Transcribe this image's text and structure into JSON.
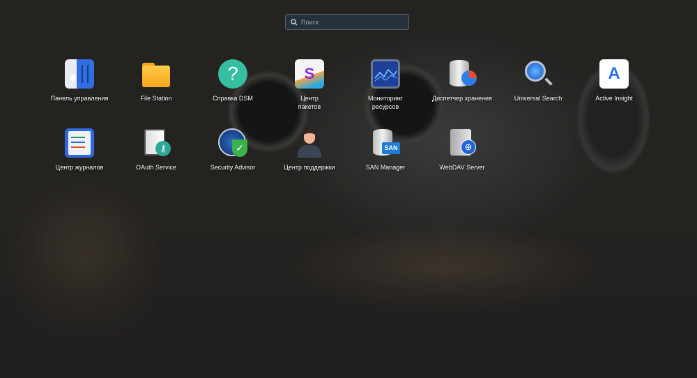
{
  "search": {
    "placeholder": "Поиск"
  },
  "apps": [
    {
      "label": "Панель управления"
    },
    {
      "label": "File Station"
    },
    {
      "label": "Справка DSM"
    },
    {
      "label": "Центр пакетов",
      "line1": "Центр",
      "line2": "пакетов"
    },
    {
      "label": "Мониторинг ресурсов",
      "line1": "Мониторинг",
      "line2": "ресурсов"
    },
    {
      "label": "Диспетчер хранения"
    },
    {
      "label": "Universal Search"
    },
    {
      "label": "Active Insight"
    },
    {
      "label": "Центр журналов"
    },
    {
      "label": "OAuth Service"
    },
    {
      "label": "Security Advisor"
    },
    {
      "label": "Центр поддержки"
    },
    {
      "label": "SAN Manager",
      "badge": "SAN"
    },
    {
      "label": "WebDAV Server"
    }
  ]
}
